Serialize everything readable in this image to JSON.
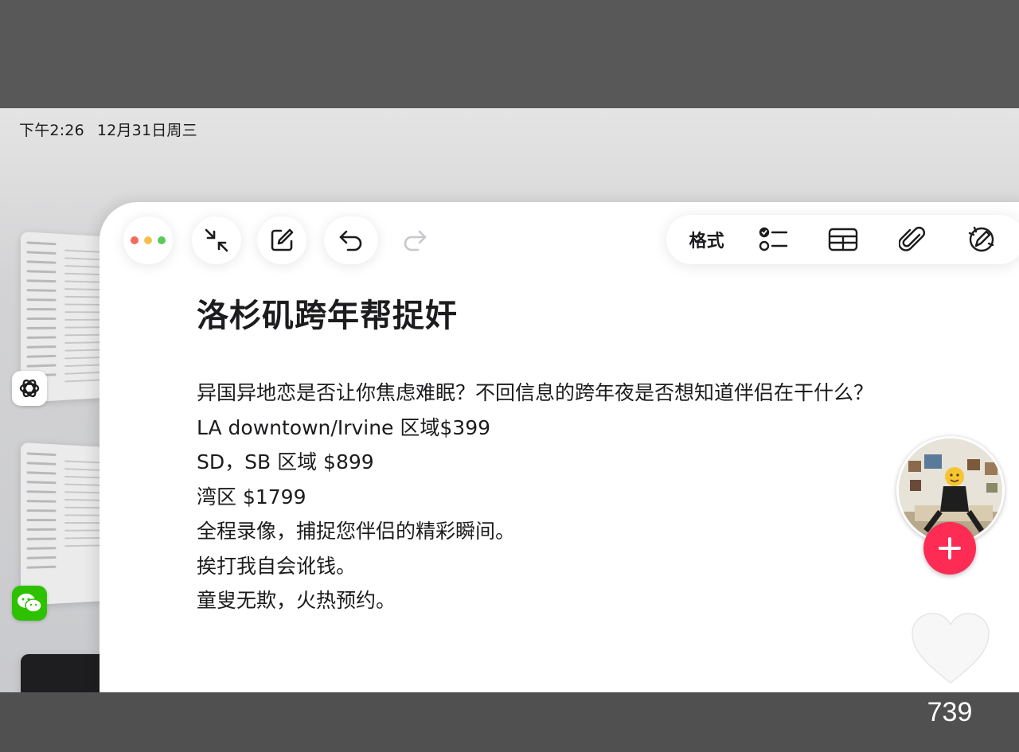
{
  "status_bar": {
    "time": "下午2:26",
    "date": "12月31日周三"
  },
  "toolbar": {
    "left_buttons": [
      "window-controls",
      "collapse-icon",
      "compose-icon",
      "undo-icon",
      "redo-icon"
    ],
    "format_label": "格式",
    "right_icons": [
      "checklist-icon",
      "table-icon",
      "paperclip-icon",
      "pen-tip-icon"
    ]
  },
  "note": {
    "title": "洛杉矶跨年帮捉奸",
    "lines": [
      "异国异地恋是否让你焦虑难眠？不回信息的跨年夜是否想知道伴侣在干什么？",
      "LA downtown/Irvine 区域$399",
      "SD，SB 区域 $899",
      "湾区 $1799",
      "全程录像，捕捉您伴侣的精彩瞬间。",
      "挨打我自会讹钱。",
      "童叟无欺，火热预约。"
    ]
  },
  "overlay": {
    "like_count": "739"
  },
  "colors": {
    "accent_red": "#fe2c55",
    "traffic_red": "#f26b5b",
    "traffic_yellow": "#f5c04f",
    "traffic_green": "#5dc85b",
    "wechat_green": "#2dc100"
  }
}
